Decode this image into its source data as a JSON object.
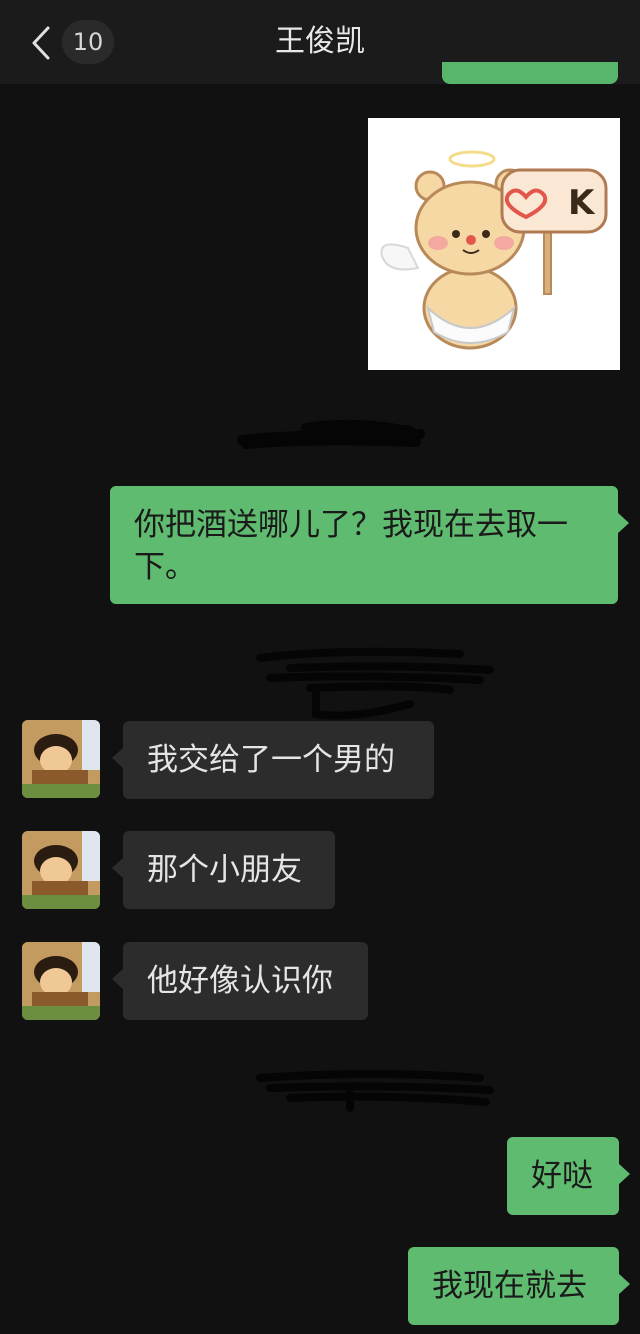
{
  "header": {
    "unread_count": "10",
    "contact_name": "王俊凯"
  },
  "sticker": {
    "label": "K"
  },
  "messages": [
    {
      "side": "out",
      "text": "你把酒送哪儿了？我现在去取一下。"
    },
    {
      "side": "in",
      "text": "我交给了一个男的"
    },
    {
      "side": "in",
      "text": "那个小朋友"
    },
    {
      "side": "in",
      "text": "他好像认识你"
    },
    {
      "side": "out",
      "text": "好哒"
    },
    {
      "side": "out",
      "text": "我现在就去"
    }
  ],
  "colors": {
    "background": "#111111",
    "outgoing_bubble": "#5fbb6f",
    "incoming_bubble": "#2c2c2c"
  }
}
